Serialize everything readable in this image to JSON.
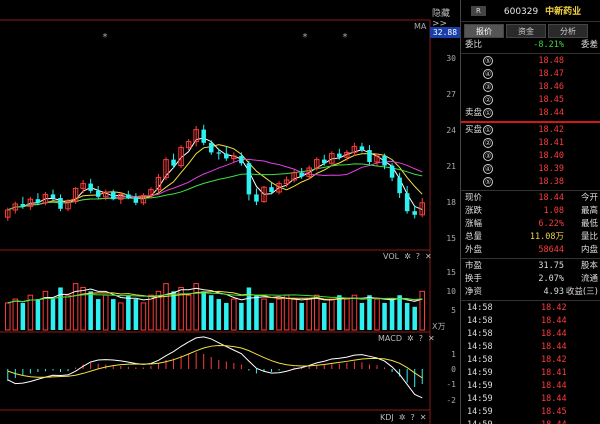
{
  "chart": {
    "hide_label": "隐藏>>",
    "ma_label": "MA",
    "current_price_tag": "32.88",
    "price_axis": [
      "30",
      "27",
      "24",
      "21",
      "18",
      "15"
    ],
    "vol_axis": [
      "15",
      "10",
      "5"
    ],
    "unit_label": "X万",
    "macd_axis": [
      "1",
      "0",
      "-1",
      "-2"
    ],
    "vol_label": "VOL",
    "macd_label": "MACD",
    "kdj_label": "KDJ",
    "gear_glyph": "✲",
    "help_glyph": "?",
    "close_glyph": "✕",
    "star_glyph": "*"
  },
  "colors": {
    "up": "#ff3b3b",
    "down": "#2ff0f0",
    "ma_white": "#ffffff",
    "ma_yellow": "#f0e040",
    "ma_purple": "#e040e0",
    "ma_green": "#40e040",
    "axis": "#8b1a1a"
  },
  "quote": {
    "badge": "R",
    "code": "600329",
    "name": "中新药业",
    "tabs": [
      "报价",
      "资金",
      "分析"
    ],
    "ratio_label": "委比",
    "ratio_value": "-8.21%",
    "diff_label": "委差",
    "asks": [
      {
        "label": "",
        "num": "⑤",
        "price": "18.48"
      },
      {
        "label": "",
        "num": "④",
        "price": "18.47"
      },
      {
        "label": "",
        "num": "③",
        "price": "18.46"
      },
      {
        "label": "",
        "num": "②",
        "price": "18.45"
      },
      {
        "label": "卖盘",
        "num": "①",
        "price": "18.44"
      }
    ],
    "bids": [
      {
        "label": "买盘",
        "num": "①",
        "price": "18.42"
      },
      {
        "label": "",
        "num": "②",
        "price": "18.41"
      },
      {
        "label": "",
        "num": "③",
        "price": "18.40"
      },
      {
        "label": "",
        "num": "④",
        "price": "18.39"
      },
      {
        "label": "",
        "num": "⑤",
        "price": "18.38"
      }
    ],
    "stats": [
      {
        "label": "现价",
        "value": "18.44",
        "cls": "red",
        "label2": "今开"
      },
      {
        "label": "涨跌",
        "value": "1.08",
        "cls": "red",
        "label2": "最高"
      },
      {
        "label": "涨幅",
        "value": "6.22%",
        "cls": "red",
        "label2": "最低"
      },
      {
        "label": "总量",
        "value": "11.08万",
        "cls": "yellow",
        "label2": "量比"
      },
      {
        "label": "外盘",
        "value": "58644",
        "cls": "red",
        "label2": "内盘"
      }
    ],
    "stats2": [
      {
        "label": "市盈",
        "value": "31.75",
        "cls": "white",
        "label2": "股本"
      },
      {
        "label": "换手",
        "value": "2.07%",
        "cls": "white",
        "label2": "流通"
      },
      {
        "label": "净资",
        "value": "4.93",
        "cls": "white",
        "label2": "收益(三)"
      }
    ],
    "ticks": [
      {
        "time": "14:58",
        "price": "18.42"
      },
      {
        "time": "14:58",
        "price": "18.44"
      },
      {
        "time": "14:58",
        "price": "18.44"
      },
      {
        "time": "14:58",
        "price": "18.44"
      },
      {
        "time": "14:58",
        "price": "18.42"
      },
      {
        "time": "14:59",
        "price": "18.41"
      },
      {
        "time": "14:59",
        "price": "18.44"
      },
      {
        "time": "14:59",
        "price": "18.44"
      },
      {
        "time": "14:59",
        "price": "18.45"
      },
      {
        "time": "14:59",
        "price": "18.44"
      }
    ]
  },
  "candles": [
    [
      16.9,
      17.7,
      16.6,
      17.5
    ],
    [
      17.5,
      18.2,
      17.2,
      18.0
    ],
    [
      18.0,
      18.6,
      17.6,
      17.8
    ],
    [
      17.8,
      18.6,
      17.5,
      18.4
    ],
    [
      18.4,
      18.9,
      17.9,
      18.1
    ],
    [
      18.1,
      19.0,
      17.9,
      18.8
    ],
    [
      18.8,
      19.2,
      18.3,
      18.5
    ],
    [
      18.5,
      18.8,
      17.4,
      17.6
    ],
    [
      17.6,
      18.4,
      17.4,
      18.2
    ],
    [
      18.2,
      19.4,
      18.0,
      19.3
    ],
    [
      19.3,
      20.0,
      18.9,
      19.7
    ],
    [
      19.7,
      20.1,
      18.9,
      19.1
    ],
    [
      19.1,
      19.5,
      18.4,
      18.6
    ],
    [
      18.6,
      19.2,
      18.3,
      19.0
    ],
    [
      19.0,
      19.2,
      18.3,
      18.4
    ],
    [
      18.4,
      19.0,
      18.0,
      18.8
    ],
    [
      18.8,
      19.1,
      18.4,
      18.5
    ],
    [
      18.5,
      18.9,
      17.9,
      18.1
    ],
    [
      18.1,
      18.9,
      17.9,
      18.7
    ],
    [
      18.7,
      19.4,
      18.5,
      19.2
    ],
    [
      19.2,
      20.5,
      19.0,
      20.2
    ],
    [
      20.2,
      21.9,
      20.0,
      21.7
    ],
    [
      21.7,
      22.2,
      21.0,
      21.2
    ],
    [
      21.2,
      22.9,
      21.0,
      22.7
    ],
    [
      22.7,
      23.4,
      22.5,
      23.2
    ],
    [
      23.2,
      24.5,
      22.8,
      24.2
    ],
    [
      24.2,
      24.6,
      22.9,
      23.1
    ],
    [
      23.1,
      23.3,
      22.1,
      22.3
    ],
    [
      22.3,
      22.6,
      21.7,
      22.2
    ],
    [
      22.2,
      22.8,
      21.6,
      21.8
    ],
    [
      21.8,
      22.3,
      21.5,
      22.0
    ],
    [
      22.0,
      22.3,
      21.2,
      21.4
    ],
    [
      21.4,
      21.6,
      18.3,
      18.8
    ],
    [
      18.8,
      19.3,
      17.9,
      18.2
    ],
    [
      18.2,
      19.5,
      18.1,
      19.4
    ],
    [
      19.4,
      19.8,
      18.8,
      19.0
    ],
    [
      19.0,
      19.9,
      18.8,
      19.7
    ],
    [
      19.7,
      20.3,
      19.4,
      20.0
    ],
    [
      20.0,
      20.9,
      19.8,
      20.6
    ],
    [
      20.6,
      21.0,
      20.1,
      20.3
    ],
    [
      20.3,
      21.2,
      20.1,
      21.0
    ],
    [
      21.0,
      21.9,
      20.8,
      21.7
    ],
    [
      21.7,
      22.1,
      21.2,
      21.4
    ],
    [
      21.4,
      22.4,
      21.2,
      22.2
    ],
    [
      22.2,
      22.6,
      21.7,
      21.9
    ],
    [
      21.9,
      22.5,
      21.6,
      22.3
    ],
    [
      22.3,
      23.1,
      22.0,
      22.8
    ],
    [
      22.8,
      23.1,
      22.3,
      22.5
    ],
    [
      22.5,
      22.9,
      21.3,
      21.5
    ],
    [
      21.5,
      22.2,
      21.2,
      22.0
    ],
    [
      22.0,
      22.2,
      20.9,
      21.2
    ],
    [
      21.2,
      21.4,
      19.9,
      20.2
    ],
    [
      20.2,
      20.6,
      18.5,
      18.9
    ],
    [
      18.9,
      19.5,
      17.2,
      17.4
    ],
    [
      17.4,
      17.9,
      16.8,
      17.1
    ],
    [
      17.1,
      18.5,
      16.9,
      18.1
    ]
  ],
  "volumes": [
    7,
    8,
    7,
    9,
    8,
    10,
    8,
    11,
    9,
    12,
    11,
    10,
    8,
    9,
    8,
    7,
    9,
    8,
    7,
    9,
    10,
    12,
    10,
    11,
    9,
    12,
    10,
    9,
    8,
    7,
    8,
    7,
    11,
    9,
    8,
    7,
    8,
    9,
    8,
    7,
    8,
    9,
    7,
    8,
    9,
    8,
    9,
    7,
    9,
    8,
    7,
    8,
    9,
    7,
    6,
    10
  ],
  "macd": [
    -0.8,
    -0.6,
    -0.4,
    -0.3,
    -0.2,
    -0.15,
    -0.1,
    -0.2,
    -0.15,
    0.1,
    0.3,
    0.4,
    0.35,
    0.3,
    0.25,
    0.2,
    0.15,
    0.1,
    0.1,
    0.2,
    0.4,
    0.6,
    0.7,
    0.9,
    1.0,
    1.1,
    1.0,
    0.8,
    0.6,
    0.5,
    0.4,
    0.3,
    -0.1,
    -0.3,
    -0.2,
    -0.2,
    -0.1,
    0.0,
    0.1,
    0.1,
    0.2,
    0.3,
    0.3,
    0.4,
    0.35,
    0.4,
    0.5,
    0.45,
    0.3,
    0.25,
    0.1,
    -0.2,
    -0.5,
    -0.9,
    -1.2,
    -1.0
  ]
}
